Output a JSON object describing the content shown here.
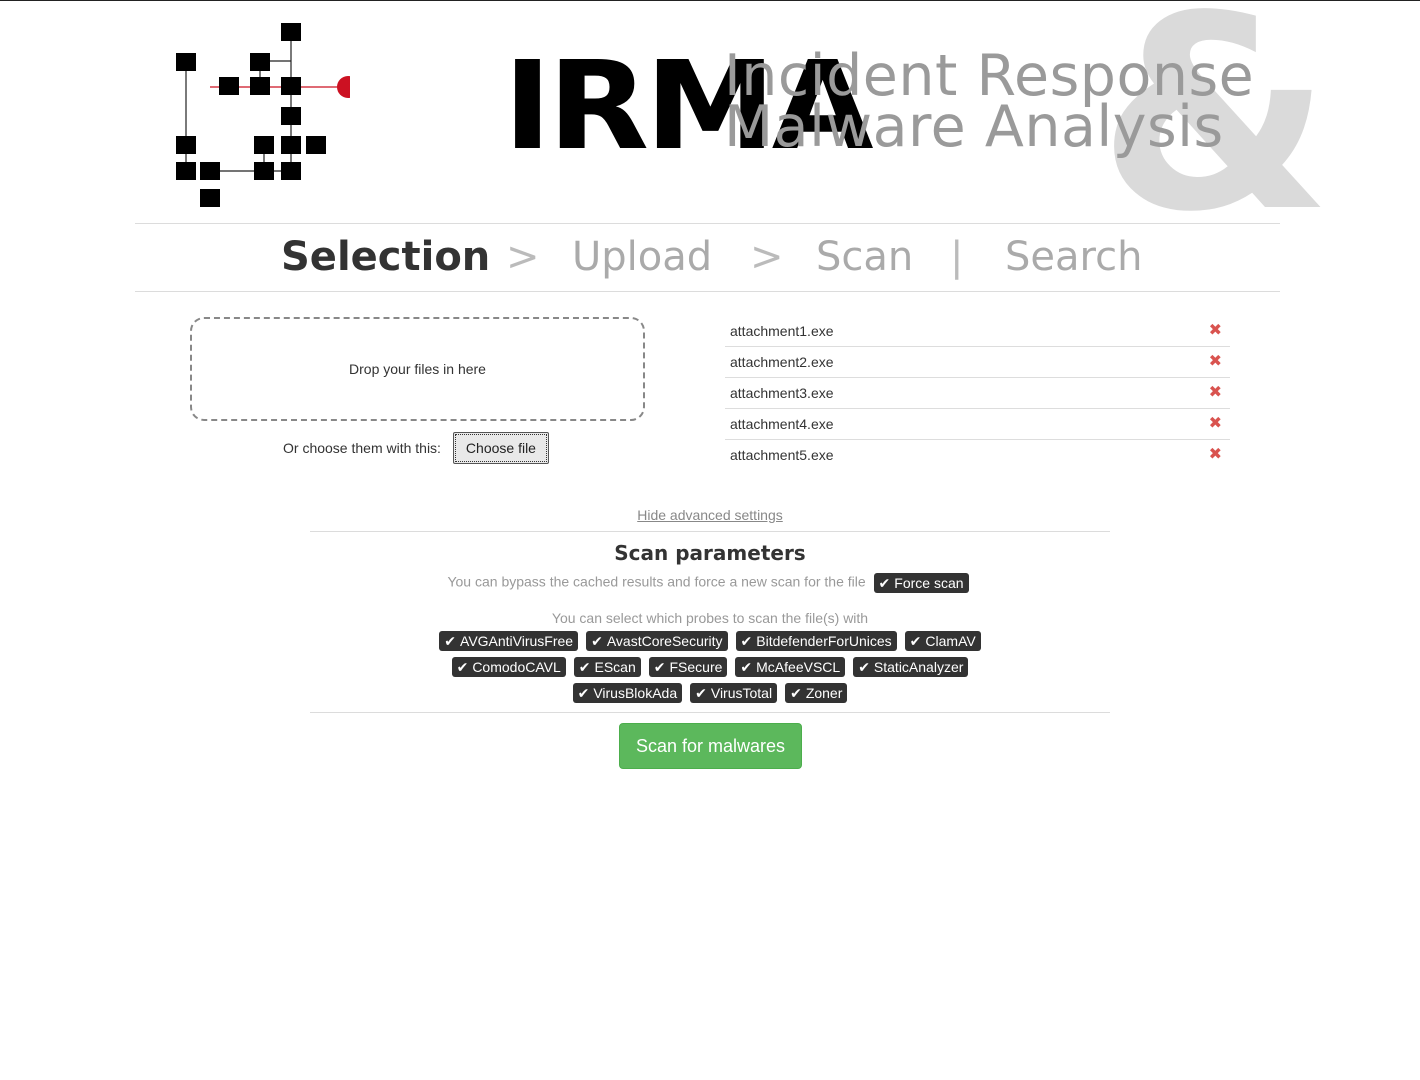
{
  "header": {
    "logo_text": "IRMA",
    "tagline_line1": "Incident Response",
    "tagline_line2": "Malware Analysis",
    "ampersand": "&"
  },
  "nav": {
    "steps": [
      "Selection",
      "Upload",
      "Scan",
      "Search"
    ],
    "active_step": "Selection",
    "separators": [
      ">",
      ">",
      "|"
    ]
  },
  "dropzone": {
    "label": "Drop your files in here",
    "choose_label": "Or choose them with this:",
    "choose_button": "Choose file"
  },
  "files": [
    {
      "name": "attachment1.exe"
    },
    {
      "name": "attachment2.exe"
    },
    {
      "name": "attachment3.exe"
    },
    {
      "name": "attachment4.exe"
    },
    {
      "name": "attachment5.exe"
    }
  ],
  "remove_icon": "✖",
  "advanced": {
    "toggle_label": "Hide advanced settings",
    "title": "Scan parameters",
    "force_text": "You can bypass the cached results and force a new scan for the file",
    "force_label": "Force scan",
    "force_checked": true,
    "probes_text": "You can select which probes to scan the file(s) with",
    "probes": [
      {
        "name": "AVGAntiVirusFree",
        "checked": true
      },
      {
        "name": "AvastCoreSecurity",
        "checked": true
      },
      {
        "name": "BitdefenderForUnices",
        "checked": true
      },
      {
        "name": "ClamAV",
        "checked": true
      },
      {
        "name": "ComodoCAVL",
        "checked": true
      },
      {
        "name": "EScan",
        "checked": true
      },
      {
        "name": "FSecure",
        "checked": true
      },
      {
        "name": "McAfeeVSCL",
        "checked": true
      },
      {
        "name": "StaticAnalyzer",
        "checked": true
      },
      {
        "name": "VirusBlokAda",
        "checked": true
      },
      {
        "name": "VirusTotal",
        "checked": true
      },
      {
        "name": "Zoner",
        "checked": true
      }
    ]
  },
  "scan_button": "Scan for malwares",
  "colors": {
    "accent_red": "#d9534f",
    "logo_red": "#cc1122",
    "primary_green": "#5cb85c",
    "tag_dark": "#333333"
  }
}
